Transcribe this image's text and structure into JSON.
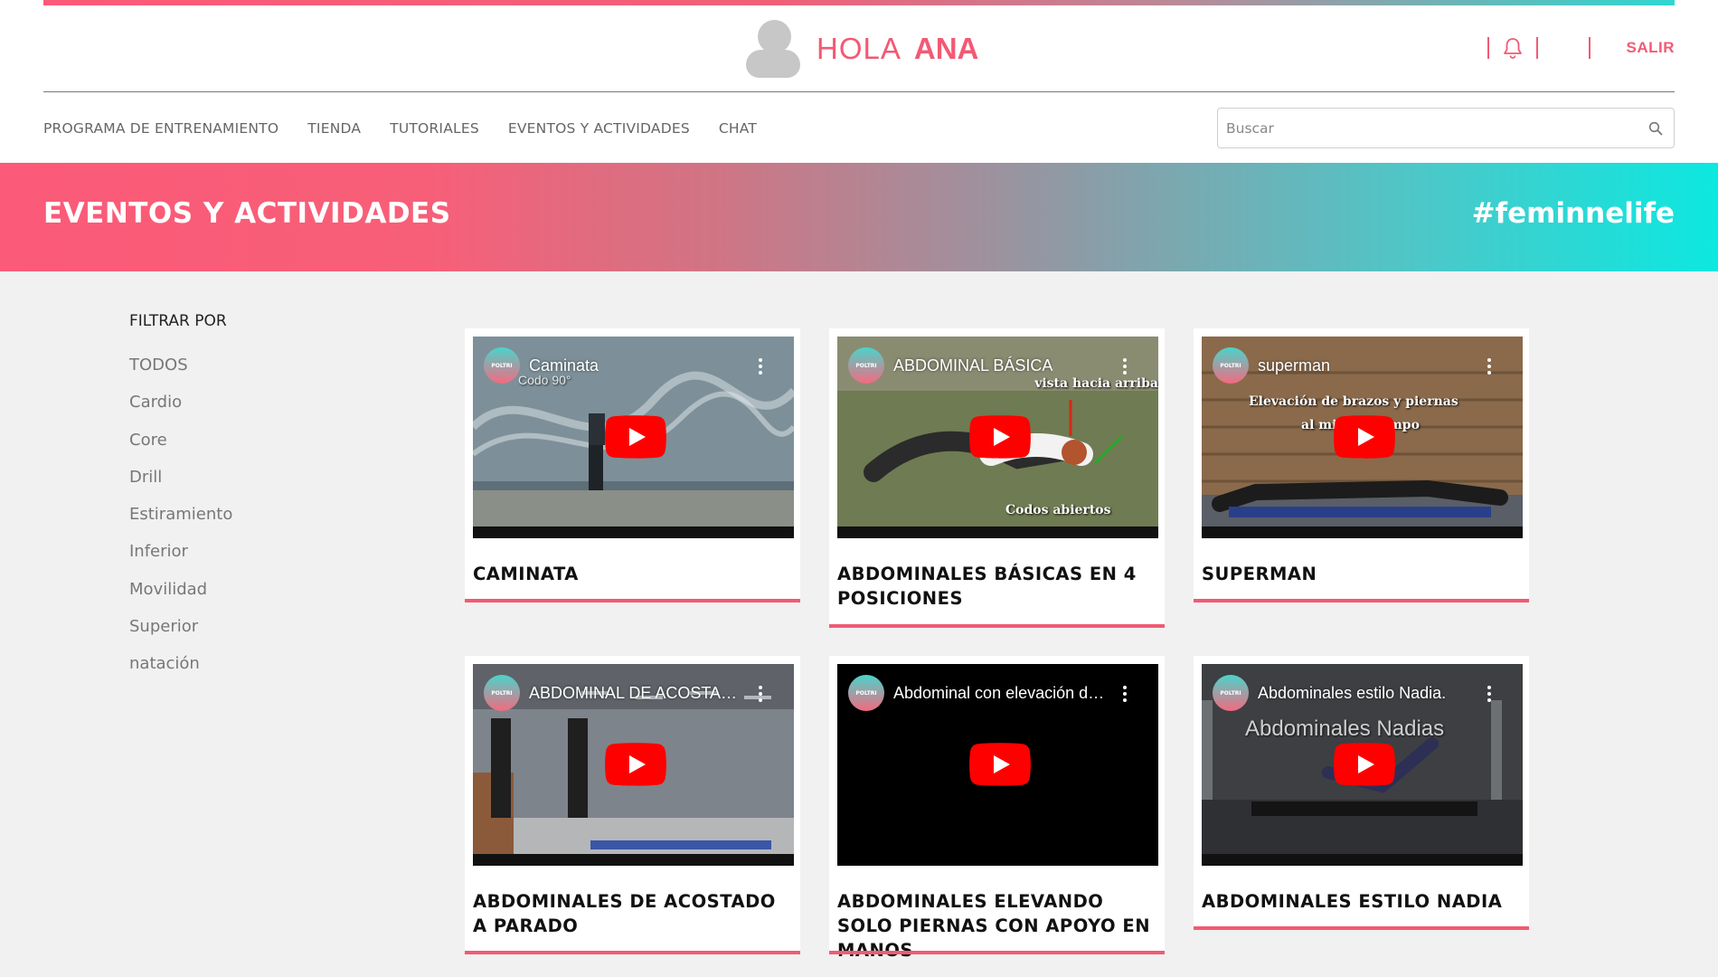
{
  "header": {
    "greeting": "HOLA",
    "user_name": "ANA",
    "logout_label": "SALIR"
  },
  "nav": {
    "items": [
      {
        "label": "PROGRAMA DE ENTRENAMIENTO"
      },
      {
        "label": "TIENDA"
      },
      {
        "label": "TUTORIALES"
      },
      {
        "label": "EVENTOS Y ACTIVIDADES"
      },
      {
        "label": "CHAT"
      }
    ],
    "search_placeholder": "Buscar"
  },
  "banner": {
    "title": "EVENTOS Y ACTIVIDADES",
    "hashtag": "#feminnelife"
  },
  "filters": {
    "heading": "FILTRAR POR",
    "items": [
      "TODOS",
      "Cardio",
      "Core",
      "Drill",
      "Estiramiento",
      "Inferior",
      "Movilidad",
      "Superior",
      "natación"
    ]
  },
  "videos": [
    {
      "title": "CAMINATA",
      "video_title": "Caminata",
      "overlay": [
        "Codo 90°"
      ]
    },
    {
      "title": "ABDOMINALES BÁSICAS EN 4 POSICIONES",
      "video_title": "ABDOMINAL BÁSICA",
      "overlay": [
        "vista hacia arriba",
        "Codos abiertos"
      ]
    },
    {
      "title": "SUPERMAN",
      "video_title": "superman",
      "overlay": [
        "Elevación de brazos y piernas",
        "al mismo tiempo"
      ]
    },
    {
      "title": "ABDOMINALES DE ACOSTADO A PARADO",
      "video_title": "ABDOMINAL DE ACOSTADO A PARADO",
      "overlay": []
    },
    {
      "title": "ABDOMINALES ELEVANDO SOLO PIERNAS CON APOYO EN MANOS",
      "video_title": "Abdominal con elevación de piernas",
      "overlay": []
    },
    {
      "title": "ABDOMINALES ESTILO NADIA",
      "video_title": "Abdominales estilo Nadia.",
      "overlay": [
        "Abdominales Nadias"
      ]
    }
  ],
  "colors": {
    "accent": "#f25a74",
    "teal": "#0ce8e0",
    "youtube_red": "#ff0000"
  }
}
